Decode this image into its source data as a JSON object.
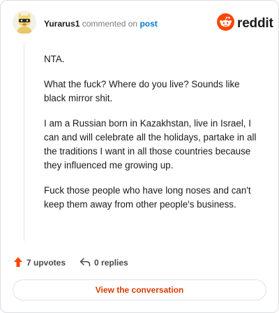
{
  "header": {
    "username": "Yurarus1",
    "action_text": "commented on",
    "post_link": "post"
  },
  "brand": {
    "wordmark": "reddit",
    "logo_icon": "reddit-snoo-icon",
    "accent_color": "#ff4500"
  },
  "comment": {
    "paragraphs": [
      "NTA.",
      "What the fuck? Where do you live? Sounds like black mirror shit.",
      "I am a Russian born in Kazakhstan, live in Israel, I can and will celebrate all the holidays, partake in all the traditions I want in all those countries because they influenced me growing up.",
      "Fuck those people who have long noses and can't keep them away from other people's business."
    ]
  },
  "stats": {
    "upvotes": "7 upvotes",
    "replies": "0 replies",
    "upvote_icon": "upvote-arrow-icon",
    "reply_icon": "reply-arrow-icon"
  },
  "cta": {
    "label": "View the conversation",
    "color": "#d93a00"
  }
}
